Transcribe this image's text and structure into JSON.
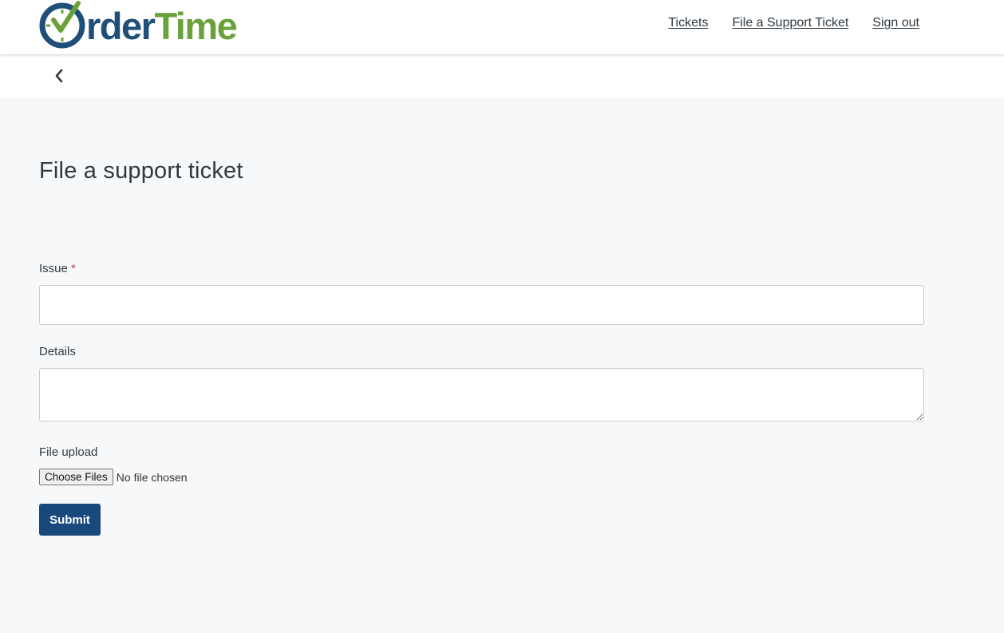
{
  "brand": {
    "logo_prefix_icon": "clock-check-icon",
    "logo_word_order": "rder",
    "logo_word_time": "Time",
    "colors": {
      "order": "#1f4e79",
      "time": "#6aa23a",
      "check": "#6aa23a"
    }
  },
  "nav": {
    "tickets": "Tickets",
    "file_ticket": "File a Support Ticket",
    "sign_out": "Sign out"
  },
  "subbar": {
    "back_icon": "chevron-left-icon"
  },
  "page": {
    "title": "File a support ticket"
  },
  "form": {
    "issue_label": "Issue",
    "issue_required_mark": "*",
    "issue_value": "",
    "details_label": "Details",
    "details_value": "",
    "file_label": "File upload",
    "choose_files": "Choose Files",
    "file_status": "No file chosen",
    "submit": "Submit"
  },
  "colors": {
    "background": "#f7f8fa",
    "primary_button": "#17497c",
    "required": "#cc3340"
  }
}
